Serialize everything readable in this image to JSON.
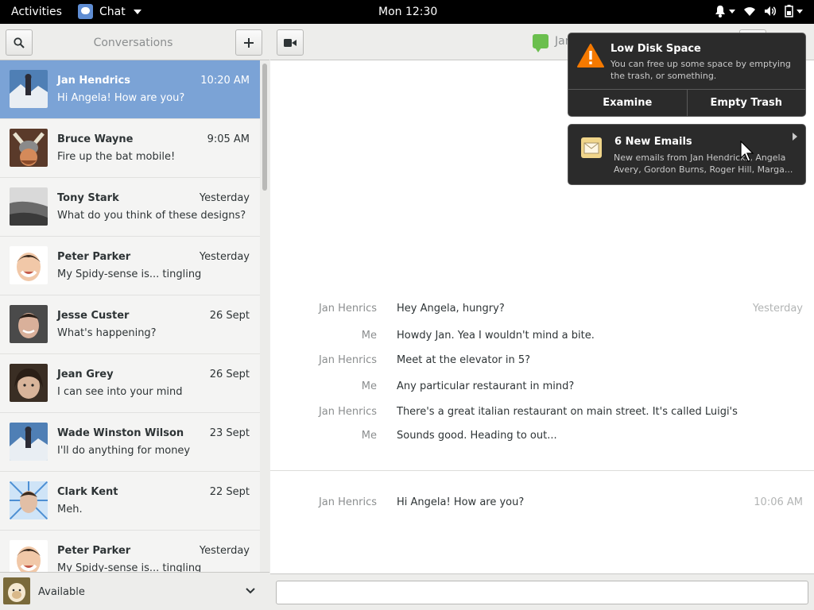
{
  "topbar": {
    "activities": "Activities",
    "app_name": "Chat",
    "clock": "Mon 12:30",
    "icons": [
      "bell-icon",
      "wifi-icon",
      "volume-icon",
      "battery-icon"
    ]
  },
  "sidebar": {
    "title": "Conversations",
    "conversations": [
      {
        "name": "Jan Hendrics",
        "time": "10:20 AM",
        "message": "Hi Angela! How are you?",
        "selected": true,
        "avatar": "snow-mountain"
      },
      {
        "name": "Bruce Wayne",
        "time": "9:05 AM",
        "message": "Fire up the bat mobile!",
        "selected": false,
        "avatar": "viking-helmet"
      },
      {
        "name": "Tony Stark",
        "time": "Yesterday",
        "message": "What do you think of these designs?",
        "selected": false,
        "avatar": "grayscale-landscape"
      },
      {
        "name": "Peter Parker",
        "time": "Yesterday",
        "message": "My Spidy-sense is... tingling",
        "selected": false,
        "avatar": "smiling-face"
      },
      {
        "name": "Jesse Custer",
        "time": "26 Sept",
        "message": "What's happening?",
        "selected": false,
        "avatar": "man-portrait"
      },
      {
        "name": "Jean Grey",
        "time": "26 Sept",
        "message": "I can see into your mind",
        "selected": false,
        "avatar": "woman-portrait"
      },
      {
        "name": "Wade Winston Wilson",
        "time": "23 Sept",
        "message": "I'll do anything for money",
        "selected": false,
        "avatar": "snow-mountain"
      },
      {
        "name": "Clark Kent",
        "time": "22 Sept",
        "message": "Meh.",
        "selected": false,
        "avatar": "blue-burst-portrait"
      },
      {
        "name": "Peter Parker",
        "time": "Yesterday",
        "message": "My Spidy-sense is... tingling",
        "selected": false,
        "avatar": "smiling-face"
      }
    ],
    "presence": "Available"
  },
  "chat": {
    "contact": "Jan Hendrics",
    "messages": [
      {
        "sender": "Jan Henrics",
        "text": "Hey Angela, hungry?",
        "stamp": "Yesterday"
      },
      {
        "sender": "Me",
        "text": "Howdy Jan. Yea I wouldn't mind a bite.",
        "stamp": ""
      },
      {
        "sender": "Jan Henrics",
        "text": "Meet at the elevator in 5?",
        "stamp": ""
      },
      {
        "sender": "Me",
        "text": "Any particular restaurant in mind?",
        "stamp": ""
      },
      {
        "sender": "Jan Henrics",
        "text": "There's a great italian restaurant on main street. It's called Luigi's",
        "stamp": ""
      },
      {
        "sender": "Me",
        "text": "Sounds good. Heading to out...",
        "stamp": ""
      }
    ],
    "latest": {
      "sender": "Jan Henrics",
      "text": "Hi Angela! How are you?",
      "stamp": "10:06 AM"
    },
    "composer_placeholder": ""
  },
  "notifications": {
    "disk": {
      "title": "Low Disk Space",
      "body": "You can free up some space by emptying the trash, or something.",
      "action_examine": "Examine",
      "action_empty": "Empty Trash"
    },
    "mail": {
      "title": "6 New Emails",
      "body": "New emails from Jan Hendricks, Angela Avery, Gordon Burns, Roger Hill, Marga..."
    }
  },
  "colors": {
    "selected_row": "#7ba3d6",
    "topbar": "#000000",
    "notification_bg": "#2b2b2b",
    "warning": "#f57900"
  }
}
